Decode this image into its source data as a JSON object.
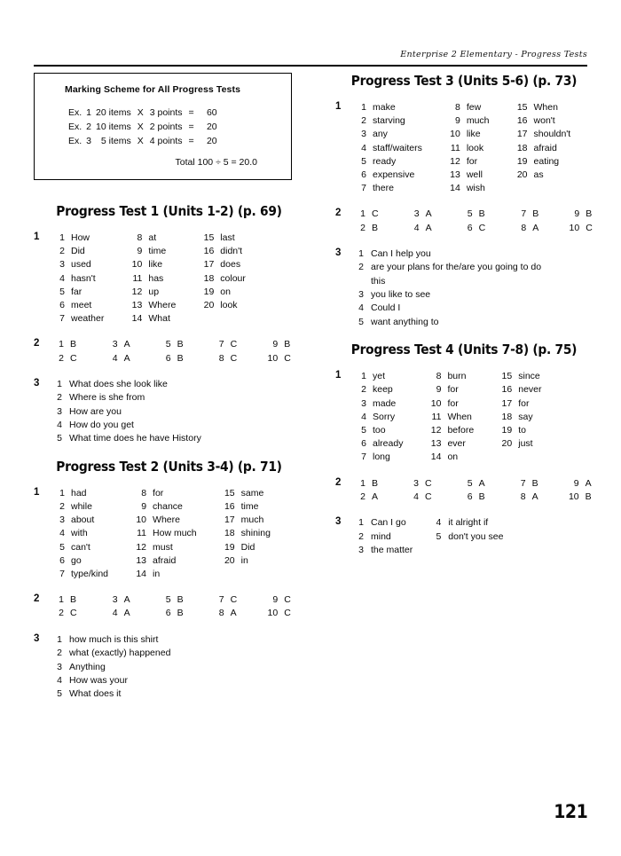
{
  "running_head": "Enterprise 2 Elementary - Progress Tests",
  "page_number": "121",
  "marking_scheme": {
    "title": "Marking Scheme for  All Progress Tests",
    "rows": [
      {
        "ex": "Ex.",
        "no": "1",
        "items": "20 items",
        "x": "X",
        "points": "3 points",
        "eq": "=",
        "value": "60"
      },
      {
        "ex": "Ex.",
        "no": "2",
        "items": "10 items",
        "x": "X",
        "points": "2 points",
        "eq": "=",
        "value": "20"
      },
      {
        "ex": "Ex.",
        "no": "3",
        "items": "5 items",
        "x": "X",
        "points": "4 points",
        "eq": "=",
        "value": "20"
      }
    ],
    "total": "Total 100 ÷ 5  =  20.0"
  },
  "tests": [
    {
      "title": "Progress Test 1 (Units 1-2) (p. 69)",
      "ex1_num": "1",
      "ex1": [
        [
          "1",
          "How"
        ],
        [
          "2",
          "Did"
        ],
        [
          "3",
          "used"
        ],
        [
          "4",
          "hasn't"
        ],
        [
          "5",
          "far"
        ],
        [
          "6",
          "meet"
        ],
        [
          "7",
          "weather"
        ],
        [
          "8",
          "at"
        ],
        [
          "9",
          "time"
        ],
        [
          "10",
          "like"
        ],
        [
          "11",
          "has"
        ],
        [
          "12",
          "up"
        ],
        [
          "13",
          "Where"
        ],
        [
          "14",
          "What"
        ],
        [
          "15",
          "last"
        ],
        [
          "16",
          "didn't"
        ],
        [
          "17",
          "does"
        ],
        [
          "18",
          "colour"
        ],
        [
          "19",
          "on"
        ],
        [
          "20",
          "look"
        ]
      ],
      "ex2_num": "2",
      "ex2": [
        [
          "1",
          "B"
        ],
        [
          "2",
          "C"
        ],
        [
          "3",
          "A"
        ],
        [
          "4",
          "A"
        ],
        [
          "5",
          "B"
        ],
        [
          "6",
          "B"
        ],
        [
          "7",
          "C"
        ],
        [
          "8",
          "C"
        ],
        [
          "9",
          "B"
        ],
        [
          "10",
          "C"
        ]
      ],
      "ex3_num": "3",
      "ex3": [
        [
          "1",
          "What does she look like"
        ],
        [
          "2",
          "Where is she from"
        ],
        [
          "3",
          "How are you"
        ],
        [
          "4",
          "How do you get"
        ],
        [
          "5",
          "What time does he have History"
        ]
      ],
      "ex3_columns": 1
    },
    {
      "title": "Progress Test 2 (Units 3-4) (p. 71)",
      "ex1_num": "1",
      "ex1": [
        [
          "1",
          "had"
        ],
        [
          "2",
          "while"
        ],
        [
          "3",
          "about"
        ],
        [
          "4",
          "with"
        ],
        [
          "5",
          "can't"
        ],
        [
          "6",
          "go"
        ],
        [
          "7",
          "type/kind"
        ],
        [
          "8",
          "for"
        ],
        [
          "9",
          "chance"
        ],
        [
          "10",
          "Where"
        ],
        [
          "11",
          "How much"
        ],
        [
          "12",
          "must"
        ],
        [
          "13",
          "afraid"
        ],
        [
          "14",
          "in"
        ],
        [
          "15",
          "same"
        ],
        [
          "16",
          "time"
        ],
        [
          "17",
          "much"
        ],
        [
          "18",
          "shining"
        ],
        [
          "19",
          "Did"
        ],
        [
          "20",
          "in"
        ]
      ],
      "ex2_num": "2",
      "ex2": [
        [
          "1",
          "B"
        ],
        [
          "2",
          "C"
        ],
        [
          "3",
          "A"
        ],
        [
          "4",
          "A"
        ],
        [
          "5",
          "B"
        ],
        [
          "6",
          "B"
        ],
        [
          "7",
          "C"
        ],
        [
          "8",
          "A"
        ],
        [
          "9",
          "C"
        ],
        [
          "10",
          "C"
        ]
      ],
      "ex3_num": "3",
      "ex3": [
        [
          "1",
          "how much is this shirt"
        ],
        [
          "2",
          "what (exactly) happened"
        ],
        [
          "3",
          "Anything"
        ],
        [
          "4",
          "How was your"
        ],
        [
          "5",
          "What does it"
        ]
      ],
      "ex3_columns": 1
    },
    {
      "title": "Progress Test 3 (Units 5-6) (p. 73)",
      "ex1_num": "1",
      "ex1": [
        [
          "1",
          "make"
        ],
        [
          "2",
          "starving"
        ],
        [
          "3",
          "any"
        ],
        [
          "4",
          "staff/waiters"
        ],
        [
          "5",
          "ready"
        ],
        [
          "6",
          "expensive"
        ],
        [
          "7",
          "there"
        ],
        [
          "8",
          "few"
        ],
        [
          "9",
          "much"
        ],
        [
          "10",
          "like"
        ],
        [
          "11",
          "look"
        ],
        [
          "12",
          "for"
        ],
        [
          "13",
          "well"
        ],
        [
          "14",
          "wish"
        ],
        [
          "15",
          "When"
        ],
        [
          "16",
          "won't"
        ],
        [
          "17",
          "shouldn't"
        ],
        [
          "18",
          "afraid"
        ],
        [
          "19",
          "eating"
        ],
        [
          "20",
          "as"
        ]
      ],
      "ex2_num": "2",
      "ex2": [
        [
          "1",
          "C"
        ],
        [
          "2",
          "B"
        ],
        [
          "3",
          "A"
        ],
        [
          "4",
          "A"
        ],
        [
          "5",
          "B"
        ],
        [
          "6",
          "C"
        ],
        [
          "7",
          "B"
        ],
        [
          "8",
          "A"
        ],
        [
          "9",
          "B"
        ],
        [
          "10",
          "C"
        ]
      ],
      "ex3_num": "3",
      "ex3": [
        [
          "1",
          "Can I help you"
        ],
        [
          "2",
          "are your plans for the/are you going to do|this"
        ],
        [
          "3",
          "you like to see"
        ],
        [
          "4",
          "Could I"
        ],
        [
          "5",
          "want anything to"
        ]
      ],
      "ex3_columns": 1
    },
    {
      "title": "Progress Test 4 (Units 7-8) (p. 75)",
      "ex1_num": "1",
      "ex1": [
        [
          "1",
          "yet"
        ],
        [
          "2",
          "keep"
        ],
        [
          "3",
          "made"
        ],
        [
          "4",
          "Sorry"
        ],
        [
          "5",
          "too"
        ],
        [
          "6",
          "already"
        ],
        [
          "7",
          "long"
        ],
        [
          "8",
          "burn"
        ],
        [
          "9",
          "for"
        ],
        [
          "10",
          "for"
        ],
        [
          "11",
          "When"
        ],
        [
          "12",
          "before"
        ],
        [
          "13",
          "ever"
        ],
        [
          "14",
          "on"
        ],
        [
          "15",
          "since"
        ],
        [
          "16",
          "never"
        ],
        [
          "17",
          "for"
        ],
        [
          "18",
          "say"
        ],
        [
          "19",
          "to"
        ],
        [
          "20",
          "just"
        ]
      ],
      "ex2_num": "2",
      "ex2": [
        [
          "1",
          "B"
        ],
        [
          "2",
          "A"
        ],
        [
          "3",
          "C"
        ],
        [
          "4",
          "C"
        ],
        [
          "5",
          "A"
        ],
        [
          "6",
          "B"
        ],
        [
          "7",
          "B"
        ],
        [
          "8",
          "A"
        ],
        [
          "9",
          "A"
        ],
        [
          "10",
          "B"
        ]
      ],
      "ex3_num": "3",
      "ex3": [
        [
          "1",
          "Can I go"
        ],
        [
          "2",
          "mind"
        ],
        [
          "3",
          "the matter"
        ],
        [
          "4",
          "it alright if"
        ],
        [
          "5",
          "don't you see"
        ]
      ],
      "ex3_columns": 2
    }
  ]
}
